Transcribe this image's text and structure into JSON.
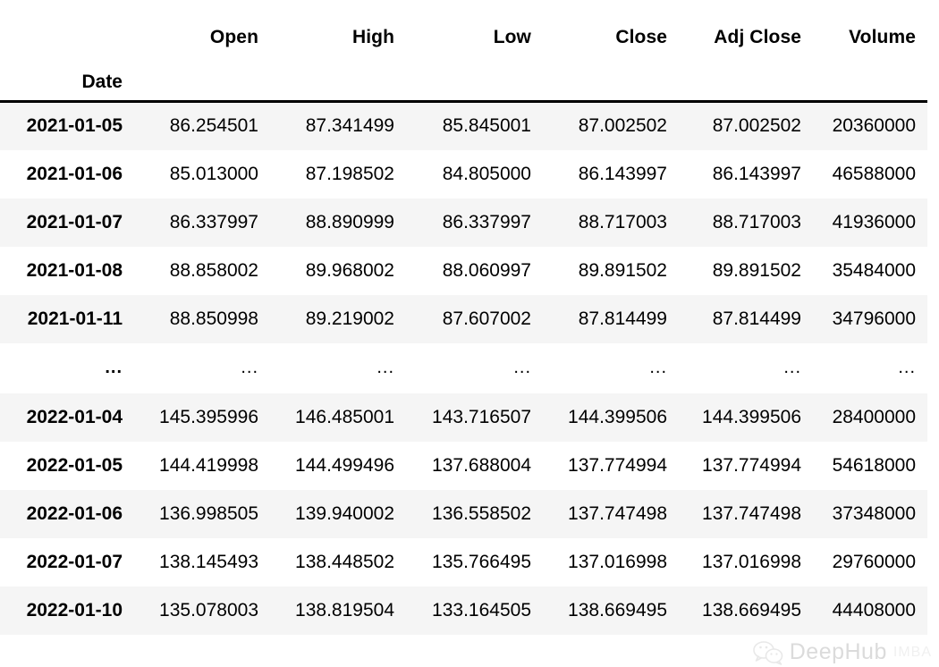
{
  "table": {
    "index_name": "Date",
    "columns": [
      "Open",
      "High",
      "Low",
      "Close",
      "Adj Close",
      "Volume"
    ],
    "ellipsis": "...",
    "rows": [
      {
        "date": "2021-01-05",
        "open": "86.254501",
        "high": "87.341499",
        "low": "85.845001",
        "close": "87.002502",
        "adj_close": "87.002502",
        "volume": "20360000"
      },
      {
        "date": "2021-01-06",
        "open": "85.013000",
        "high": "87.198502",
        "low": "84.805000",
        "close": "86.143997",
        "adj_close": "86.143997",
        "volume": "46588000"
      },
      {
        "date": "2021-01-07",
        "open": "86.337997",
        "high": "88.890999",
        "low": "86.337997",
        "close": "88.717003",
        "adj_close": "88.717003",
        "volume": "41936000"
      },
      {
        "date": "2021-01-08",
        "open": "88.858002",
        "high": "89.968002",
        "low": "88.060997",
        "close": "89.891502",
        "adj_close": "89.891502",
        "volume": "35484000"
      },
      {
        "date": "2021-01-11",
        "open": "88.850998",
        "high": "89.219002",
        "low": "87.607002",
        "close": "87.814499",
        "adj_close": "87.814499",
        "volume": "34796000"
      },
      {
        "date": "...",
        "open": "...",
        "high": "...",
        "low": "...",
        "close": "...",
        "adj_close": "...",
        "volume": "..."
      },
      {
        "date": "2022-01-04",
        "open": "145.395996",
        "high": "146.485001",
        "low": "143.716507",
        "close": "144.399506",
        "adj_close": "144.399506",
        "volume": "28400000"
      },
      {
        "date": "2022-01-05",
        "open": "144.419998",
        "high": "144.499496",
        "low": "137.688004",
        "close": "137.774994",
        "adj_close": "137.774994",
        "volume": "54618000"
      },
      {
        "date": "2022-01-06",
        "open": "136.998505",
        "high": "139.940002",
        "low": "136.558502",
        "close": "137.747498",
        "adj_close": "137.747498",
        "volume": "37348000"
      },
      {
        "date": "2022-01-07",
        "open": "138.145493",
        "high": "138.448502",
        "low": "135.766495",
        "close": "137.016998",
        "adj_close": "137.016998",
        "volume": "29760000"
      },
      {
        "date": "2022-01-10",
        "open": "135.078003",
        "high": "138.819504",
        "low": "133.164505",
        "close": "138.669495",
        "adj_close": "138.669495",
        "volume": "44408000"
      }
    ]
  },
  "watermark": {
    "brand": "DeepHub",
    "sub": "IMBA",
    "icon": "wechat-icon"
  },
  "colors": {
    "text": "#000000",
    "stripe": "#f5f5f5",
    "background": "#ffffff",
    "header_rule": "#000000",
    "watermark_text": "#8a8a8a"
  }
}
